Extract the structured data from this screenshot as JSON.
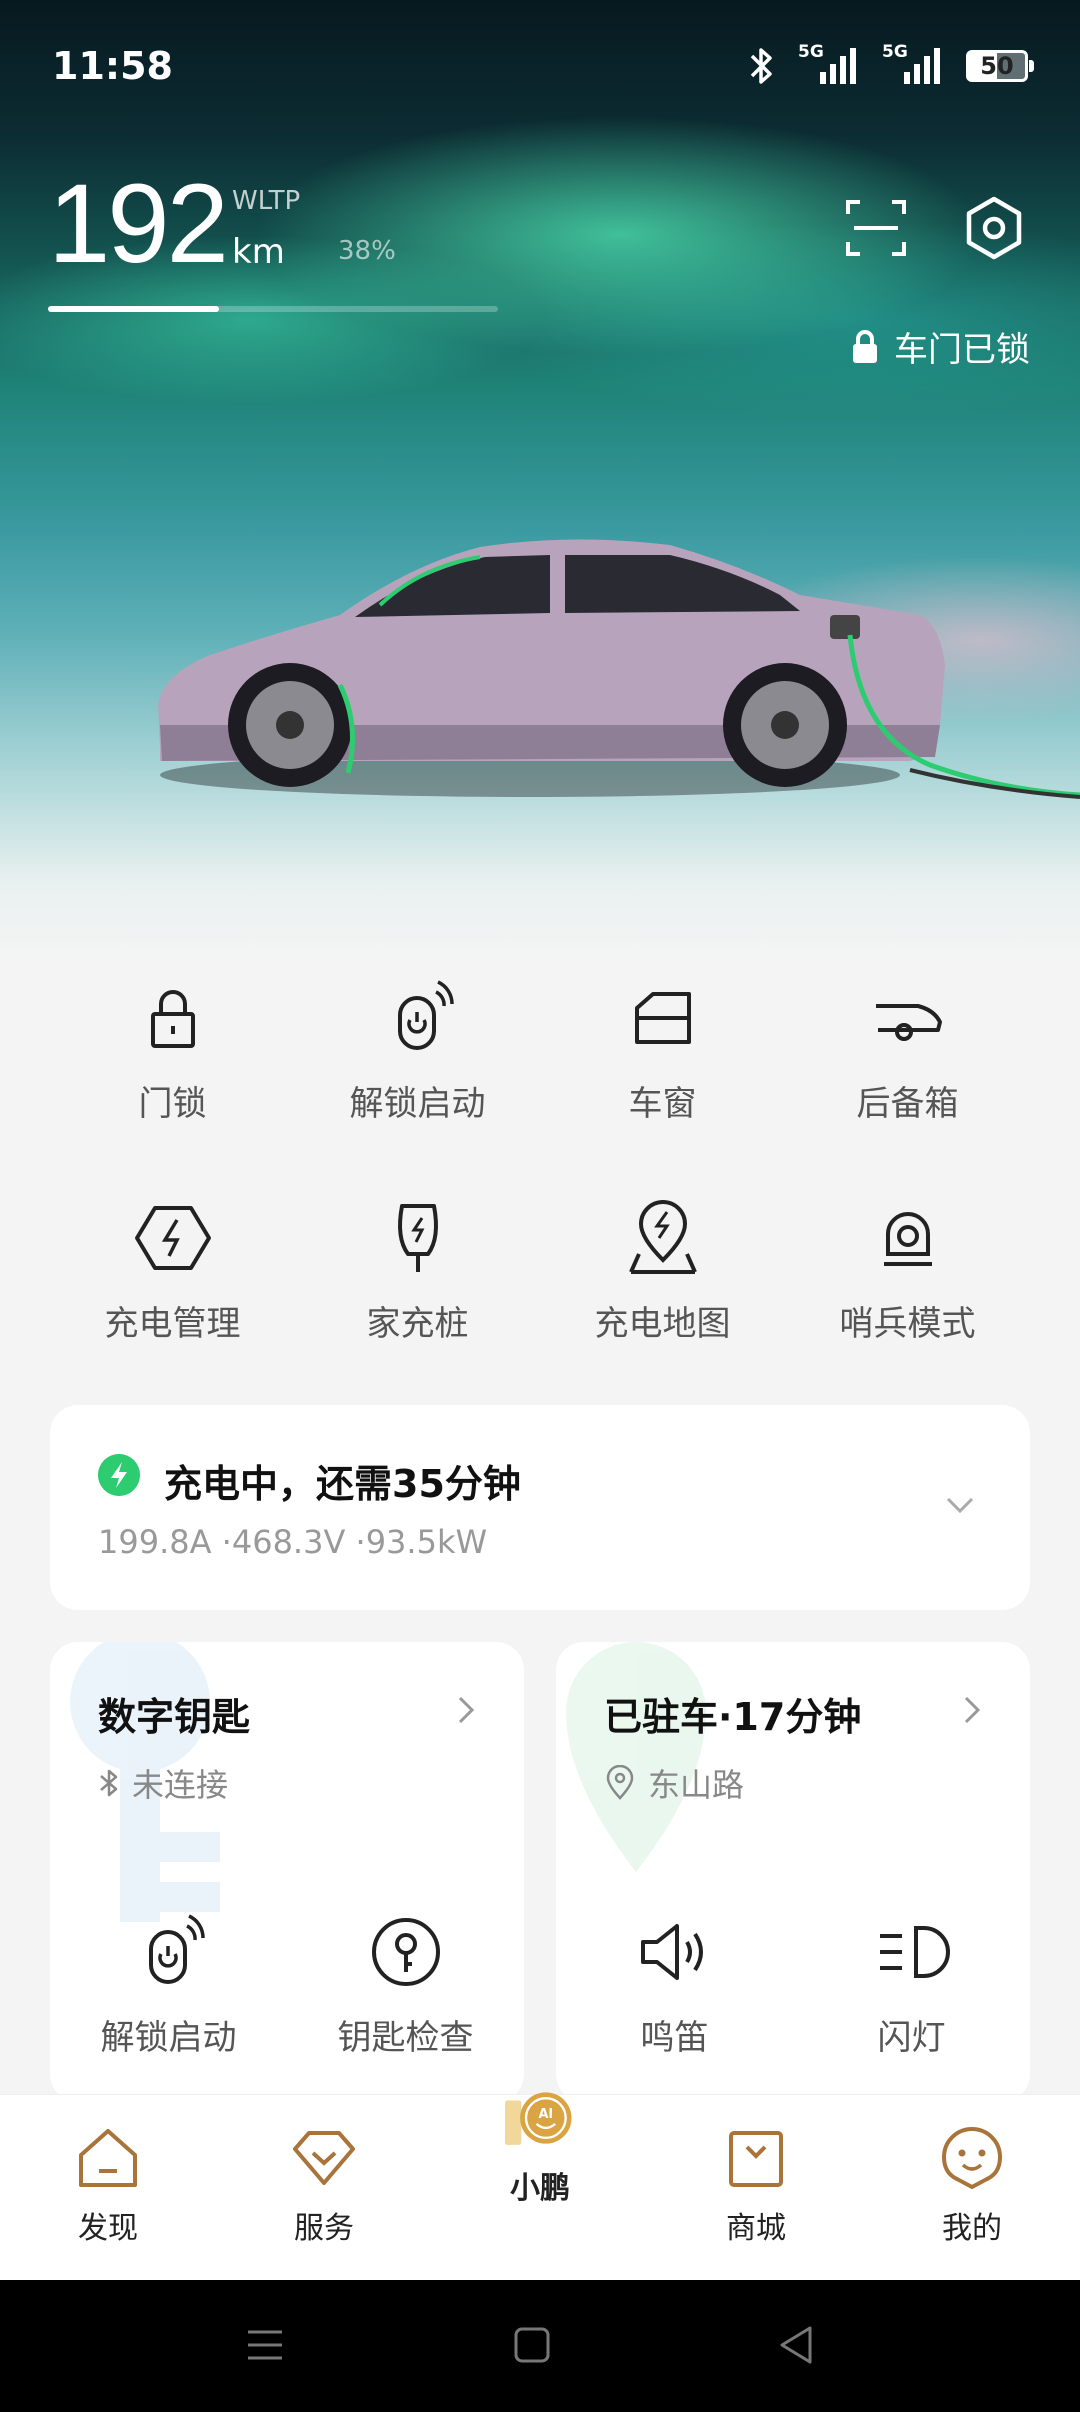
{
  "status_bar": {
    "time": "11:58",
    "network_1": "5G",
    "network_2": "5G",
    "battery_level": "50"
  },
  "vehicle": {
    "range_value": "192",
    "range_standard": "WLTP",
    "range_unit": "km",
    "battery_percent": "38%",
    "battery_fraction": 0.38,
    "door_status": "车门已锁"
  },
  "quick_controls": [
    {
      "label": "门锁",
      "icon": "lock-icon"
    },
    {
      "label": "解锁启动",
      "icon": "unlock-start-icon"
    },
    {
      "label": "车窗",
      "icon": "window-icon"
    },
    {
      "label": "后备箱",
      "icon": "trunk-icon"
    },
    {
      "label": "充电管理",
      "icon": "charge-manage-icon"
    },
    {
      "label": "家充桩",
      "icon": "home-charger-icon"
    },
    {
      "label": "充电地图",
      "icon": "charge-map-icon"
    },
    {
      "label": "哨兵模式",
      "icon": "sentry-icon"
    }
  ],
  "charging": {
    "title": "充电中，还需35分钟",
    "details": "199.8A ·468.3V ·93.5kW"
  },
  "digital_key": {
    "title": "数字钥匙",
    "status": "未连接",
    "actions": [
      {
        "label": "解锁启动",
        "icon": "unlock-start-icon"
      },
      {
        "label": "钥匙检查",
        "icon": "key-check-icon"
      }
    ]
  },
  "parking": {
    "title": "已驻车·17分钟",
    "location": "东山路",
    "actions": [
      {
        "label": "鸣笛",
        "icon": "horn-icon"
      },
      {
        "label": "闪灯",
        "icon": "flash-lights-icon"
      }
    ]
  },
  "bottom_nav": [
    {
      "label": "发现",
      "icon": "home-icon"
    },
    {
      "label": "服务",
      "icon": "service-icon"
    },
    {
      "label": "小鹏",
      "icon": "ai-icon",
      "badge": "AI"
    },
    {
      "label": "商城",
      "icon": "shop-icon"
    },
    {
      "label": "我的",
      "icon": "profile-icon"
    }
  ],
  "colors": {
    "accent_charge": "#2ecc71",
    "nav_brand": "#b07a38",
    "ai_gold": "#d9a441"
  }
}
